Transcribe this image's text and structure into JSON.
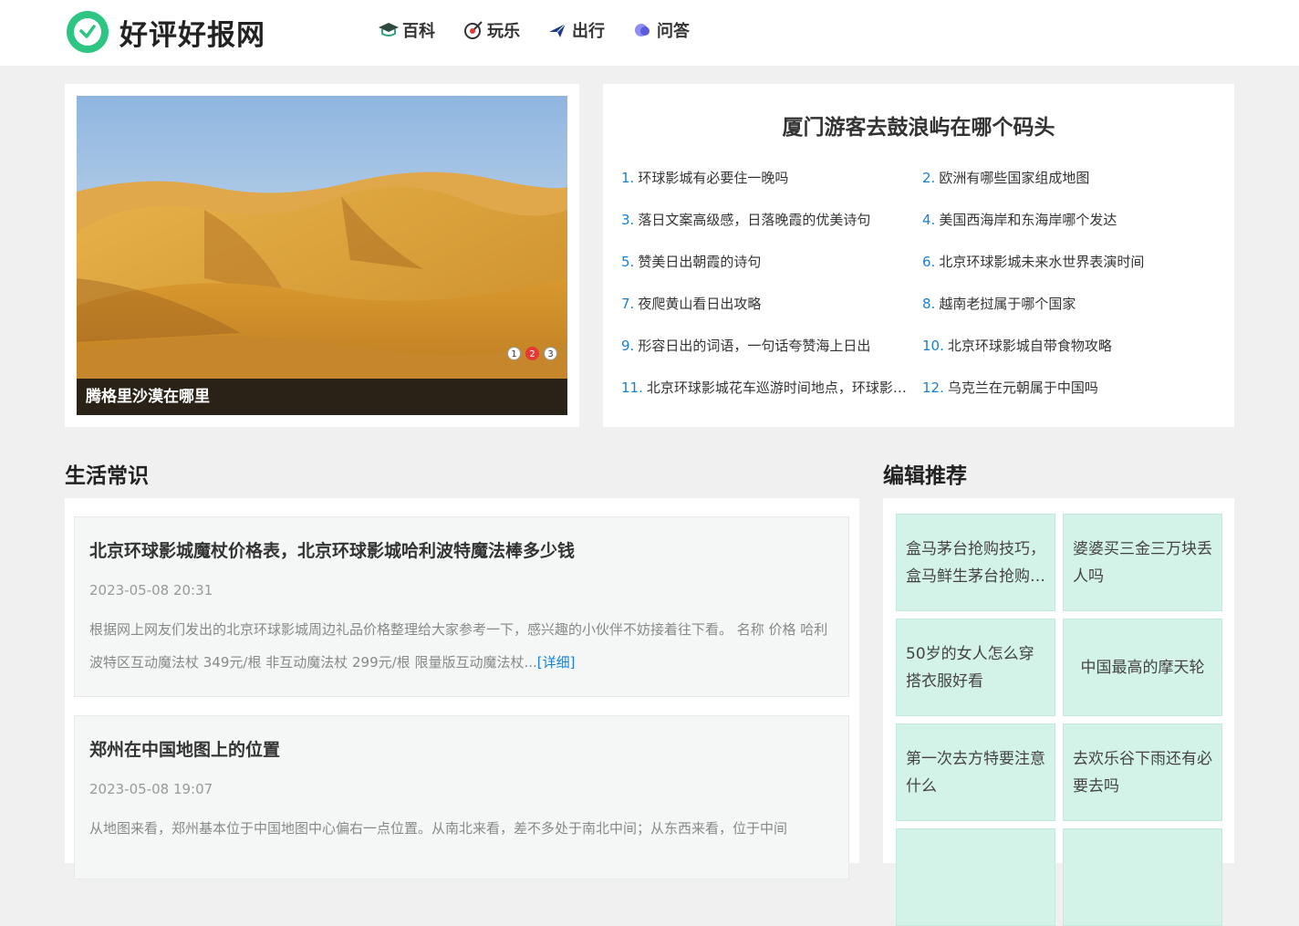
{
  "header": {
    "site_name": "好评好报网",
    "nav": [
      {
        "label": "百科",
        "icon": "graduation-cap-icon"
      },
      {
        "label": "玩乐",
        "icon": "target-icon"
      },
      {
        "label": "出行",
        "icon": "plane-icon"
      },
      {
        "label": "问答",
        "icon": "chat-bubble-icon"
      }
    ]
  },
  "carousel": {
    "caption": "腾格里沙漠在哪里",
    "dots": [
      "1",
      "2",
      "3"
    ],
    "active_dot": 2
  },
  "hot": {
    "title": "厦门游客去鼓浪屿在哪个码头",
    "items": [
      {
        "num": "1.",
        "text": "环球影城有必要住一晚吗"
      },
      {
        "num": "2.",
        "text": "欧洲有哪些国家组成地图"
      },
      {
        "num": "3.",
        "text": "落日文案高级感，日落晚霞的优美诗句"
      },
      {
        "num": "4.",
        "text": "美国西海岸和东海岸哪个发达"
      },
      {
        "num": "5.",
        "text": "赞美日出朝霞的诗句"
      },
      {
        "num": "6.",
        "text": "北京环球影城未来水世界表演时间"
      },
      {
        "num": "7.",
        "text": "夜爬黄山看日出攻略"
      },
      {
        "num": "8.",
        "text": "越南老挝属于哪个国家"
      },
      {
        "num": "9.",
        "text": "形容日出的词语，一句话夸赞海上日出"
      },
      {
        "num": "10.",
        "text": "北京环球影城自带食物攻略"
      },
      {
        "num": "11.",
        "text": "北京环球影城花车巡游时间地点，环球影城花车巡游几点开始"
      },
      {
        "num": "12.",
        "text": "乌克兰在元朝属于中国吗"
      }
    ]
  },
  "life": {
    "title": "生活常识",
    "articles": [
      {
        "title": "北京环球影城魔杖价格表，北京环球影城哈利波特魔法棒多少钱",
        "date": "2023-05-08 20:31",
        "desc": "根据网上网友们发出的北京环球影城周边礼品价格整理给大家参考一下，感兴趣的小伙伴不妨接着往下看。 名称 价格 哈利波特区互动魔法杖 349元/根 非互动魔法杖 299元/根 限量版互动魔法杖...",
        "more": "[详细]"
      },
      {
        "title": "郑州在中国地图上的位置",
        "date": "2023-05-08 19:07",
        "desc": "从地图来看，郑州基本位于中国地图中心偏右一点位置。从南北来看，差不多处于南北中间；从东西来看，位于中间",
        "more": ""
      }
    ]
  },
  "recommend": {
    "title": "编辑推荐",
    "items": [
      "盒马茅台抢购技巧，盒马鲜生茅台抢购攻略",
      "婆婆买三金三万块丢人吗",
      "50岁的女人怎么穿搭衣服好看",
      "中国最高的摩天轮",
      "第一次去方特要注意什么",
      "去欢乐谷下雨还有必要去吗",
      "",
      ""
    ]
  }
}
